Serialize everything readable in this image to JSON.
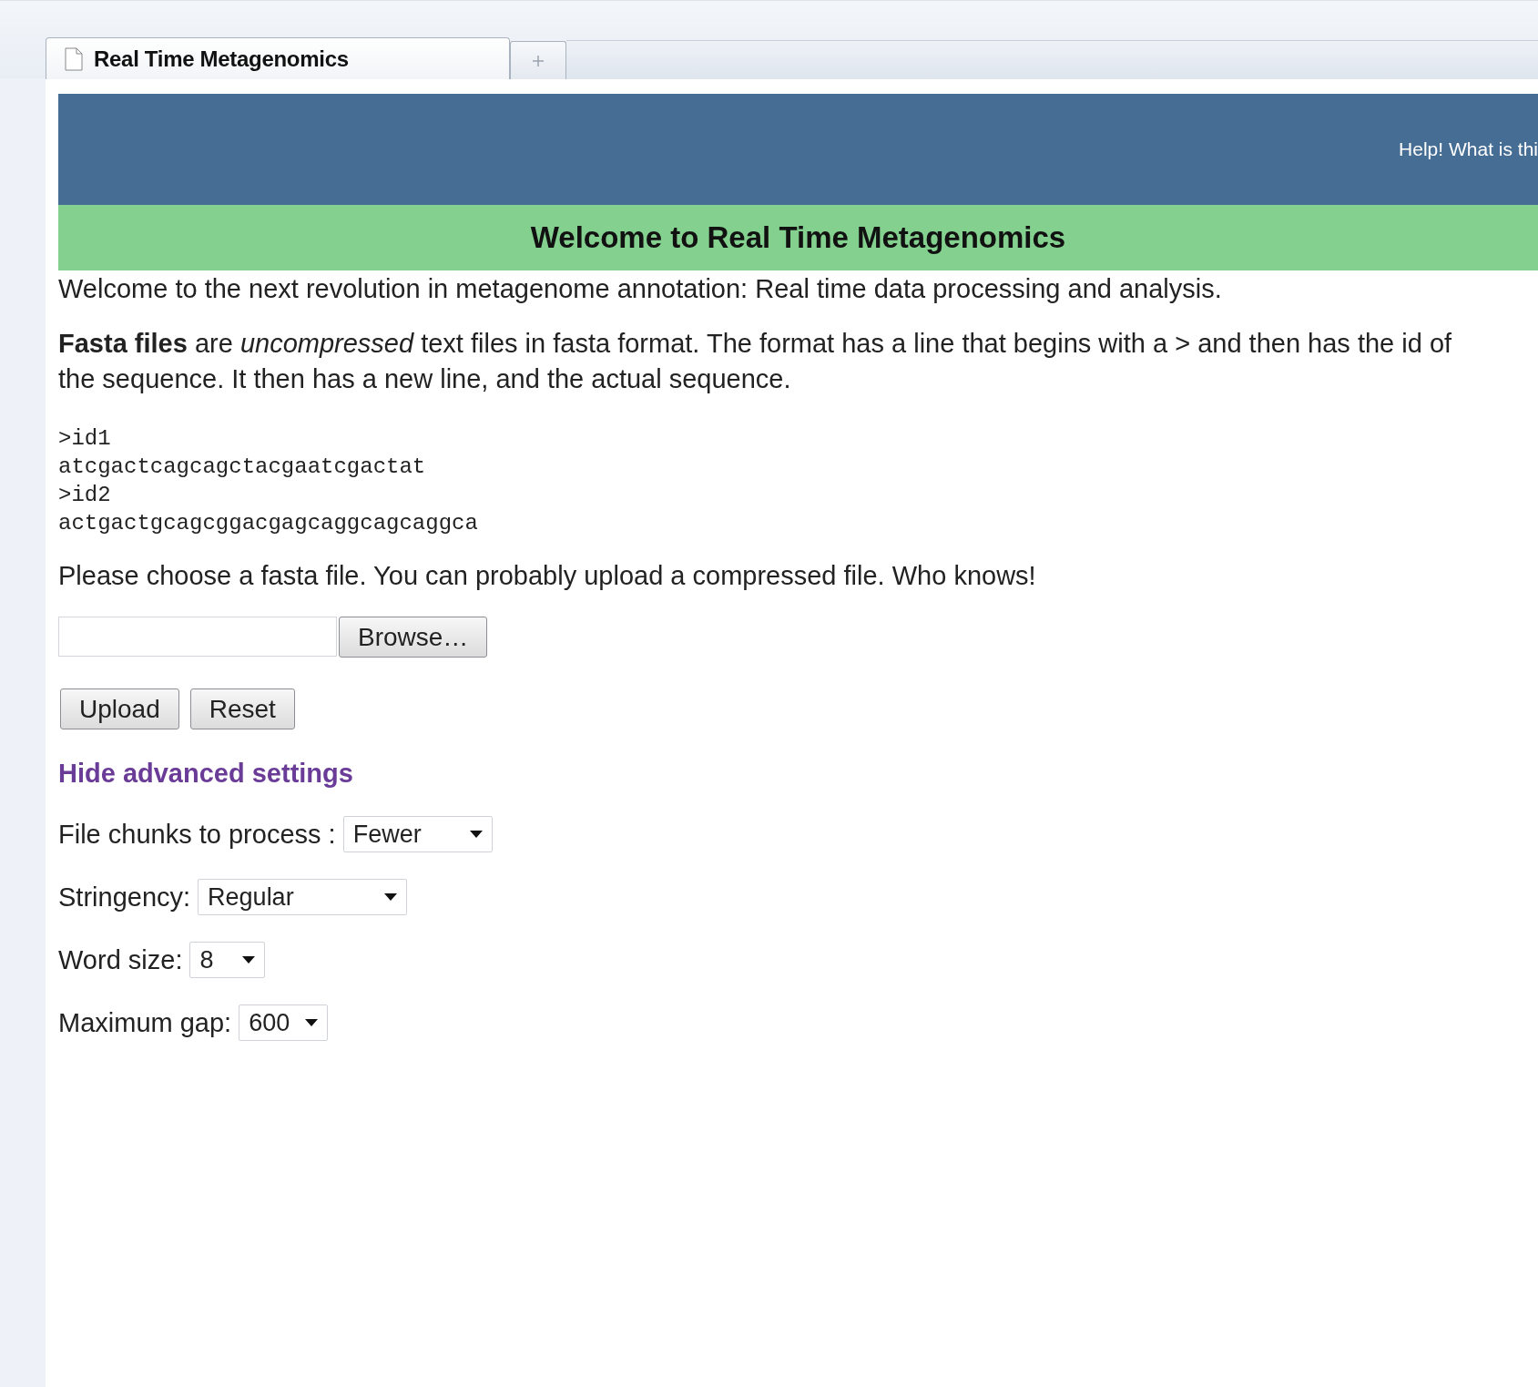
{
  "browser": {
    "tabs": [
      {
        "title": "Real Time Metagenomics",
        "selected": true
      }
    ]
  },
  "header": {
    "help_link": "Help! What is thi"
  },
  "banner": {
    "title": "Welcome to Real Time Metagenomics"
  },
  "intro": "Welcome to the next revolution in metagenome annotation: Real time data processing and analysis.",
  "description": "**Fasta files** are *uncompressed* text files in fasta format. The format has a line that begins with a > and then has the id of the sequence. It then has a new line, and the actual sequence.",
  "code_sample": [
    ">id1",
    "atcgactcagcagctacgaatcgactat",
    ">id2",
    "actgactgcagcggacgagcaggcagcaggca"
  ],
  "prompt": "Please choose a fasta file. You can probably upload a compressed file. Who knows!",
  "file_field": {
    "button": "Browse…"
  },
  "buttons": [
    "Upload",
    "Reset"
  ],
  "advanced_toggle": "Hide advanced settings",
  "settings": [
    {
      "label": "File chunks to process :",
      "value": "Fewer"
    },
    {
      "label": "Stringency:",
      "value": "Regular"
    },
    {
      "label": "Word size:",
      "value": "8"
    },
    {
      "label": "Maximum gap:",
      "value": "600"
    }
  ]
}
